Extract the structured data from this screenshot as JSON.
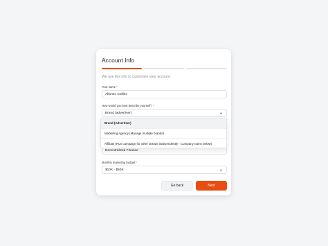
{
  "form": {
    "title": "Account Info",
    "subtitle": "We use this info to customize your account",
    "progress": {
      "total_steps": 3,
      "current_step": 1
    },
    "name_label": "Your name",
    "name_value": "Alfonso Collins",
    "describe_label": "How would you best describe yourself?",
    "describe_value": "Brand (advertiser)",
    "industry_value": "Decentralized Finance",
    "budget_label": "Monthly marketing budget",
    "budget_value": "$10K - $50K",
    "required_mark": "*"
  },
  "dropdown": {
    "options": [
      "Brand (Advertiser)",
      "Marketing Agency (Manage multiple brands)",
      "Affiliate (Run campaign for other brands independently - Company name below)"
    ],
    "selected_index": 0
  },
  "actions": {
    "back_label": "Go back",
    "next_label": "Next"
  },
  "colors": {
    "accent": "#e84e12",
    "background": "#f4f5f6",
    "card": "#ffffff"
  },
  "icons": {
    "select_arrow": "chevron-down-icon"
  }
}
